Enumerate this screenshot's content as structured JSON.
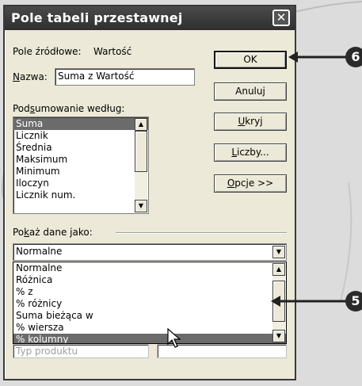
{
  "dialog": {
    "title": "Pole tabeli przestawnej",
    "close_glyph": "✕"
  },
  "source": {
    "label": "Pole źródłowe:",
    "value": "Wartość"
  },
  "name": {
    "label_prefix": "",
    "label_accel": "N",
    "label_rest": "azwa:",
    "value": "Suma z Wartość"
  },
  "summarize": {
    "label_pre": "Pod",
    "label_accel": "s",
    "label_rest": "umowanie według:",
    "items": [
      "Suma",
      "Licznik",
      "Średnia",
      "Maksimum",
      "Minimum",
      "Iloczyn",
      "Licznik num."
    ],
    "selected": "Suma"
  },
  "buttons": {
    "ok": "OK",
    "cancel": "Anuluj",
    "hide_accel": "U",
    "hide_rest": "kryj",
    "numbers_accel": "L",
    "numbers_rest": "iczby...",
    "options_accel": "O",
    "options_rest": "pcje >>"
  },
  "show_as": {
    "label_pre": "Po",
    "label_accel": "k",
    "label_rest": "aż dane jako:",
    "value": "Normalne",
    "options": [
      "Normalne",
      "Różnica",
      "% z",
      "% różnicy",
      "Suma bieżąca w",
      "% wiersza",
      "% kolumny"
    ],
    "highlighted": "% kolumny"
  },
  "hidden_behind": {
    "base_field_fragment": "Typ produktu"
  },
  "callouts": {
    "ok_callout": "6",
    "list_callout": "5"
  }
}
